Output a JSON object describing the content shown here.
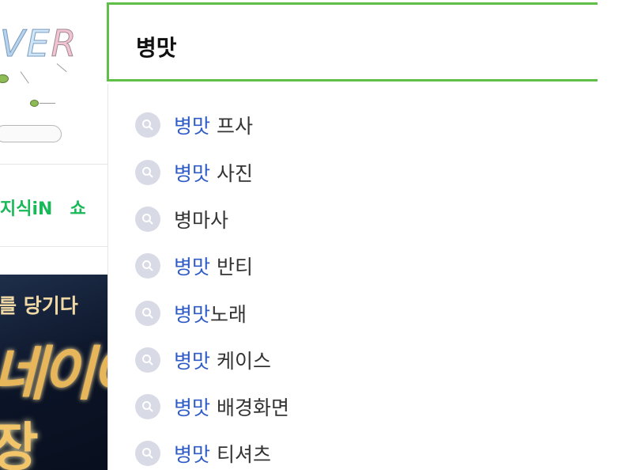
{
  "logo": {
    "text": "VER"
  },
  "nav": {
    "items": [
      "지식iN",
      "쇼"
    ]
  },
  "banner": {
    "line1": "를 당기다",
    "line2": "네이이",
    "line3": "장"
  },
  "search": {
    "value": "병맛"
  },
  "suggestions": [
    {
      "highlight": "병맛",
      "rest": " 프사"
    },
    {
      "highlight": "병맛",
      "rest": " 사진"
    },
    {
      "highlight": "",
      "rest": "병마사"
    },
    {
      "highlight": "병맛",
      "rest": " 반티"
    },
    {
      "highlight": "병맛",
      "rest": "노래"
    },
    {
      "highlight": "병맛",
      "rest": " 케이스"
    },
    {
      "highlight": "병맛",
      "rest": " 배경화면"
    },
    {
      "highlight": "병맛",
      "rest": " 티셔츠"
    }
  ],
  "colors": {
    "accent": "#5fbf46",
    "highlight": "#2f5cc7",
    "nav": "#19b858"
  }
}
